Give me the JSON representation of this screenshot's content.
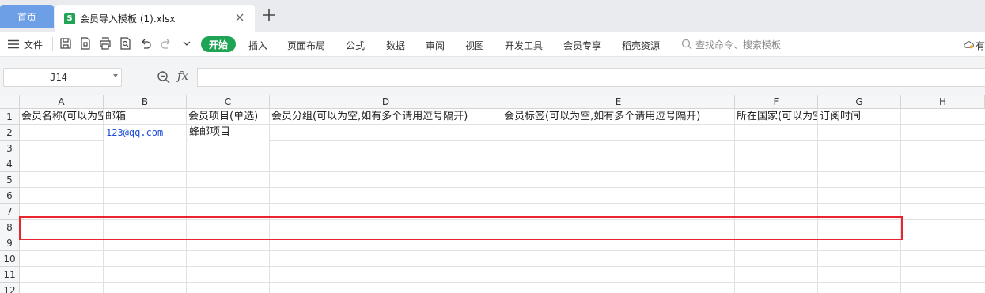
{
  "tabs": {
    "home": "首页",
    "file": "会员导入模板 (1).xlsx",
    "xls_icon_letter": "S"
  },
  "ribbon": {
    "menu": "文件",
    "start": "开始",
    "tabs": [
      "插入",
      "页面布局",
      "公式",
      "数据",
      "审阅",
      "视图",
      "开发工具",
      "会员专享",
      "稻壳资源"
    ],
    "search": "查找命令、搜索模板",
    "cloud_label": "有",
    "icons": [
      "menu-icon",
      "save-icon",
      "export-pdf-icon",
      "print-icon",
      "print-preview-icon",
      "undo-icon",
      "redo-icon",
      "more-icon",
      "search-icon",
      "cloud-icon"
    ]
  },
  "formula_bar": {
    "cell_ref": "J14",
    "fx": "fx",
    "formula": ""
  },
  "sheet": {
    "columns": [
      "A",
      "B",
      "C",
      "D",
      "E",
      "F",
      "G",
      "H"
    ],
    "rows": [
      "1",
      "2",
      "3",
      "4",
      "5",
      "6",
      "7",
      "8",
      "9",
      "10",
      "11",
      "12"
    ],
    "row1": [
      "会员名称(可以为空)",
      "邮箱",
      "会员项目(单选)",
      "会员分组(可以为空,如有多个请用逗号隔开)",
      "会员标签(可以为空,如有多个请用逗号隔开)",
      "所在国家(可以为空)",
      "订阅时间"
    ],
    "row2": {
      "email": "123@qq.com",
      "project": "蜂邮项目"
    }
  },
  "colors": {
    "accent_green": "#1fa456",
    "home_tab": "#6c9fe6",
    "selection_red": "#e8242d",
    "link_blue": "#1f4fd6"
  }
}
